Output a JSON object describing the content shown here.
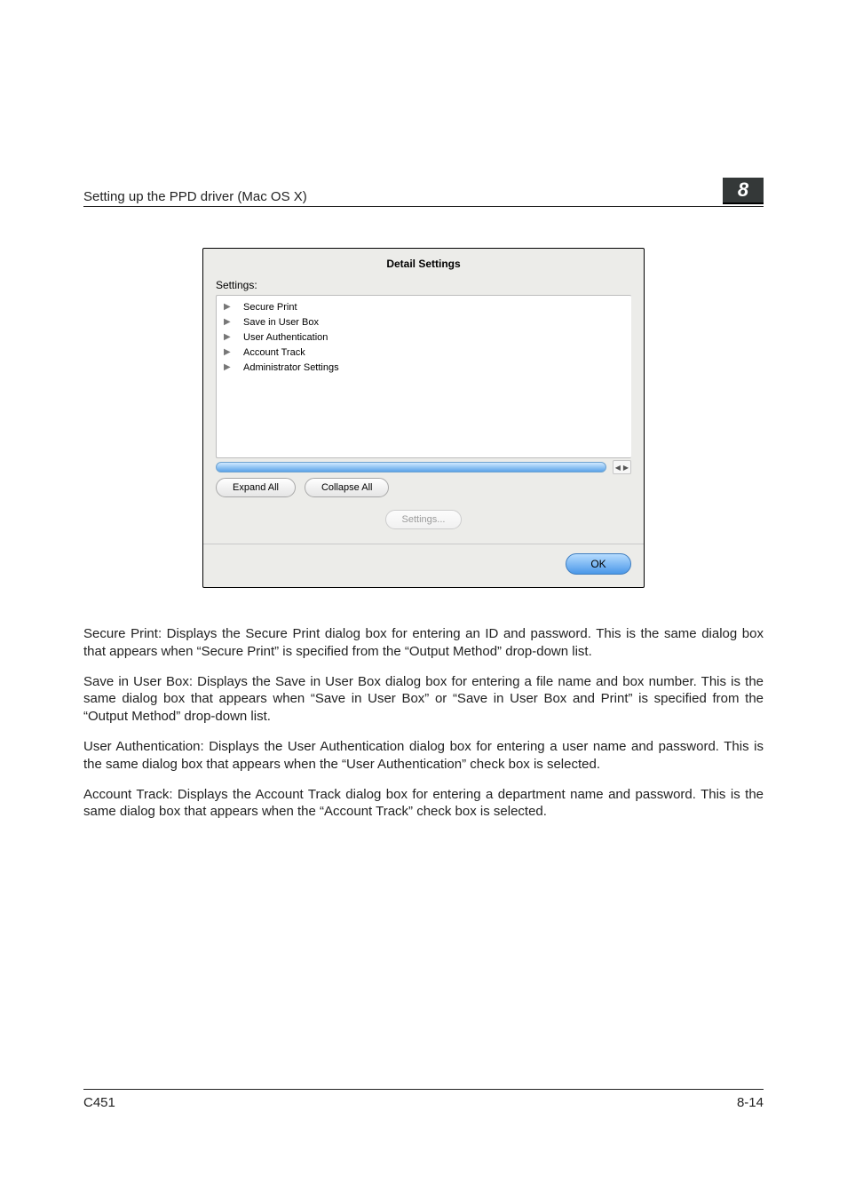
{
  "header": {
    "title": "Setting up the PPD driver (Mac OS X)",
    "chapter_number": "8"
  },
  "dialog": {
    "title": "Detail Settings",
    "settings_label": "Settings:",
    "items": [
      "Secure Print",
      "Save in User Box",
      "User Authentication",
      "Account Track",
      "Administrator Settings"
    ],
    "expand_all": "Expand All",
    "collapse_all": "Collapse All",
    "settings_button": "Settings...",
    "ok": "OK"
  },
  "paragraphs": {
    "p1": "Secure Print: Displays the Secure Print dialog box for entering an ID and password. This is the same dialog box that appears when “Secure Print” is specified from the “Output Method” drop-down list.",
    "p2": "Save in User Box: Displays the Save in User Box dialog box for entering a file name and box number. This is the same dialog box that appears when “Save in User Box” or “Save in User Box and Print” is specified from the “Output Method” drop-down list.",
    "p3": "User Authentication: Displays the User Authentication dialog box for entering a user name and password. This is the same dialog box that appears when the “User Authentication” check box is selected.",
    "p4": "Account Track: Displays the Account Track dialog box for entering a department name and password. This is the same dialog box that appears when the “Account Track” check box is selected."
  },
  "footer": {
    "model": "C451",
    "page": "8-14"
  }
}
